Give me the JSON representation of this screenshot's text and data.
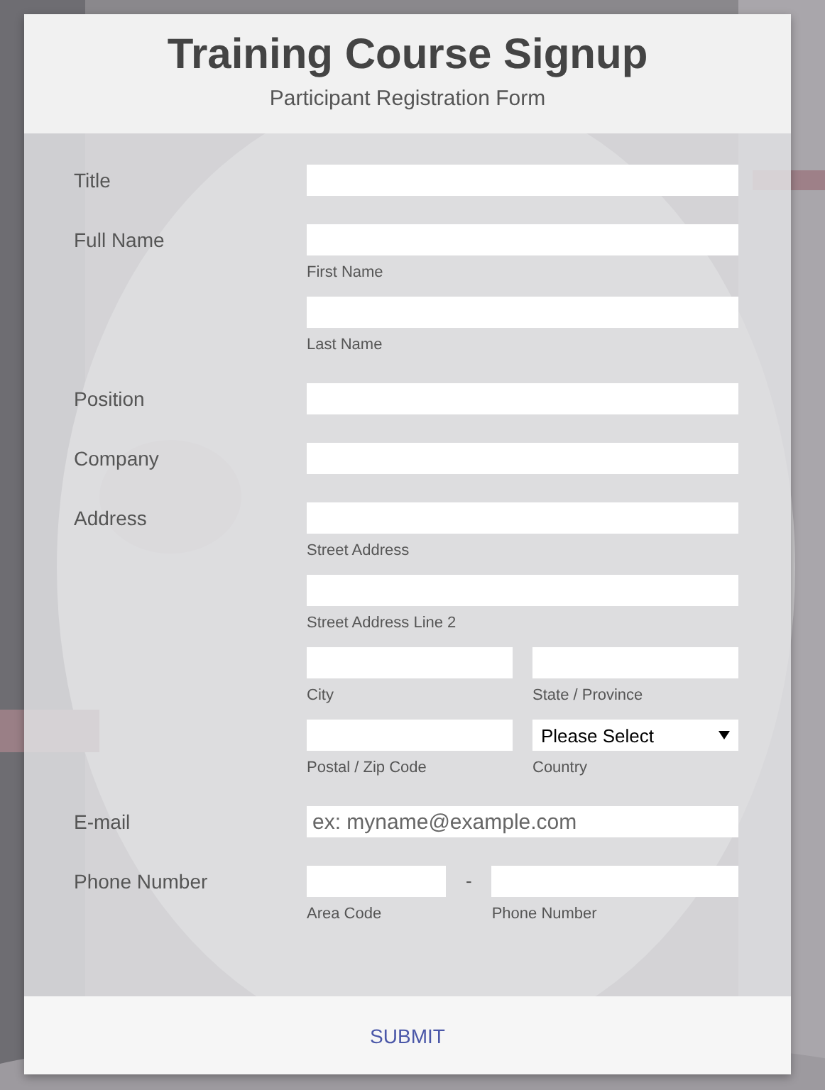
{
  "header": {
    "title": "Training Course Signup",
    "subtitle": "Participant Registration Form"
  },
  "rows": [
    {
      "label": "Title",
      "lines": [
        [
          {
            "kind": "text"
          }
        ]
      ]
    },
    {
      "label": "Full Name",
      "lines": [
        [
          {
            "kind": "text",
            "sublabel": "First Name"
          }
        ],
        [
          {
            "kind": "text",
            "sublabel": "Last Name"
          }
        ]
      ]
    },
    {
      "label": "Position",
      "lines": [
        [
          {
            "kind": "text"
          }
        ]
      ]
    },
    {
      "label": "Company",
      "lines": [
        [
          {
            "kind": "text"
          }
        ]
      ]
    },
    {
      "label": "Address",
      "lines": [
        [
          {
            "kind": "text",
            "sublabel": "Street Address"
          }
        ],
        [
          {
            "kind": "text",
            "sublabel": "Street Address Line 2"
          }
        ],
        [
          {
            "kind": "text",
            "sublabel": "City"
          },
          {
            "kind": "text",
            "sublabel": "State / Province"
          }
        ],
        [
          {
            "kind": "text",
            "sublabel": "Postal / Zip Code"
          },
          {
            "kind": "select",
            "value": "Please Select",
            "sublabel": "Country"
          }
        ]
      ]
    },
    {
      "label": "E-mail",
      "lines": [
        [
          {
            "kind": "text",
            "placeholder": "ex: myname@example.com"
          }
        ]
      ]
    },
    {
      "label": "Phone Number",
      "lines": [
        [
          {
            "kind": "text",
            "sublabel": "Area Code",
            "narrow": true
          },
          {
            "kind": "separator",
            "text": "-"
          },
          {
            "kind": "text",
            "sublabel": "Phone Number"
          }
        ]
      ]
    }
  ],
  "submit": "SUBMIT"
}
